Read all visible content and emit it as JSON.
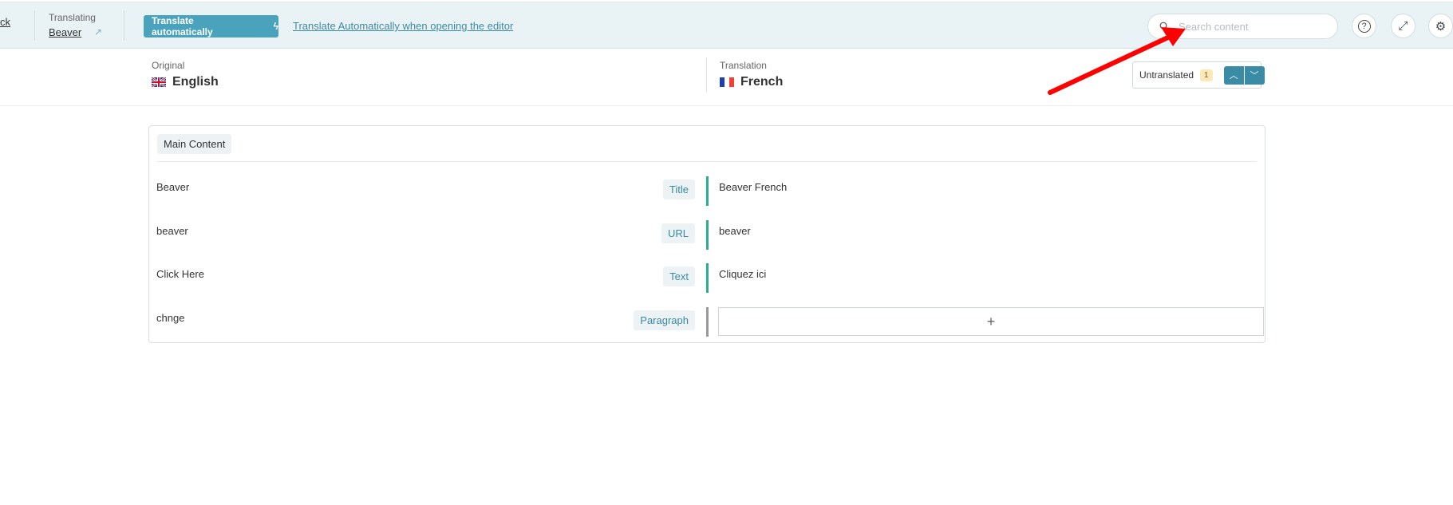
{
  "header": {
    "back_label": "ck",
    "translating_label": "Translating",
    "page_name": "Beaver",
    "auto_button": "Translate automatically",
    "auto_link": "Translate Automatically when opening the editor",
    "search_placeholder": "Search content"
  },
  "languages": {
    "original_label": "Original",
    "original_lang": "English",
    "translation_label": "Translation",
    "translation_lang": "French"
  },
  "filter": {
    "label": "Untranslated",
    "count": "1"
  },
  "section": {
    "title": "Main Content",
    "rows": [
      {
        "original": "Beaver",
        "type": "Title",
        "translation": "Beaver French",
        "status": "translated"
      },
      {
        "original": "beaver",
        "type": "URL",
        "translation": "beaver",
        "status": "translated"
      },
      {
        "original": "Click Here",
        "type": "Text",
        "translation": "Cliquez ici",
        "status": "translated"
      },
      {
        "original": "chnge",
        "type": "Paragraph",
        "translation": "",
        "status": "untranslated"
      }
    ]
  },
  "colors": {
    "accent": "#4aa3bd",
    "translated": "#2bae8f",
    "annotation": "#ff0000"
  }
}
